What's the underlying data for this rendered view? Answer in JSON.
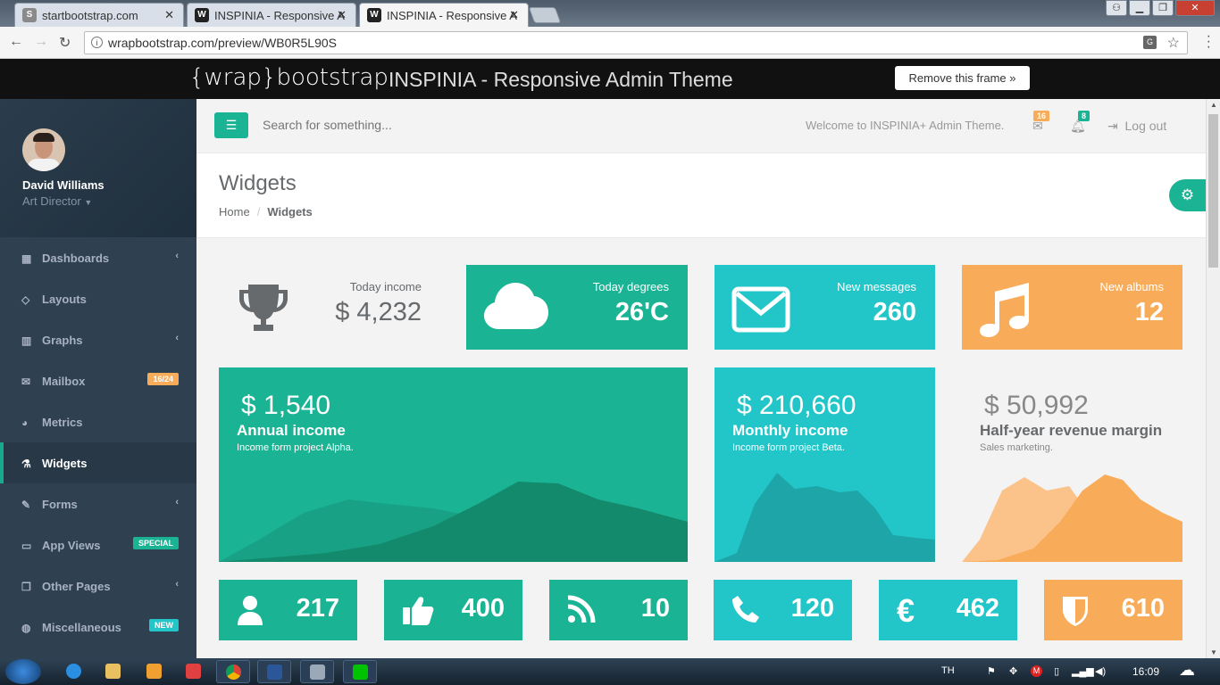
{
  "browser": {
    "tabs": [
      {
        "title": "startbootstrap.com",
        "favicon": "S",
        "active": false
      },
      {
        "title": "INSPINIA - Responsive A",
        "favicon": "W",
        "active": false
      },
      {
        "title": "INSPINIA - Responsive A",
        "favicon": "W",
        "active": true
      }
    ],
    "url": "wrapbootstrap.com/preview/WB0R5L90S"
  },
  "frame": {
    "logo": "{wrap}bootstrap",
    "title": "INSPINIA - Responsive Admin Theme",
    "remove_button": "Remove this frame »"
  },
  "profile": {
    "name": "David Williams",
    "role": "Art Director"
  },
  "sidebar": {
    "items": [
      {
        "label": "Dashboards",
        "icon": "th-large-icon",
        "glyph": "▦",
        "arrow": true
      },
      {
        "label": "Layouts",
        "icon": "diamond-icon",
        "glyph": "◇",
        "arrow": false
      },
      {
        "label": "Graphs",
        "icon": "bar-chart-icon",
        "glyph": "▥",
        "arrow": true
      },
      {
        "label": "Mailbox",
        "icon": "envelope-icon",
        "glyph": "✉",
        "badge": "16/24",
        "badge_color": "#f8ac59"
      },
      {
        "label": "Metrics",
        "icon": "pie-chart-icon",
        "glyph": "◕",
        "arrow": false
      },
      {
        "label": "Widgets",
        "icon": "flask-icon",
        "glyph": "⚗",
        "active": true
      },
      {
        "label": "Forms",
        "icon": "edit-icon",
        "glyph": "✎",
        "arrow": true
      },
      {
        "label": "App Views",
        "icon": "desktop-icon",
        "glyph": "▭",
        "badge": "SPECIAL",
        "badge_color": "#1ab394"
      },
      {
        "label": "Other Pages",
        "icon": "files-icon",
        "glyph": "❐",
        "arrow": true
      },
      {
        "label": "Miscellaneous",
        "icon": "globe-icon",
        "glyph": "◍",
        "badge": "NEW",
        "badge_color": "#23c6c8"
      }
    ]
  },
  "topbar": {
    "search_placeholder": "Search for something...",
    "welcome": "Welcome to INSPINIA+ Admin Theme.",
    "messages_count": "16",
    "alerts_count": "8",
    "logout": "Log out"
  },
  "page": {
    "title": "Widgets",
    "breadcrumb": [
      "Home",
      "Widgets"
    ]
  },
  "stats": [
    {
      "label": "Today income",
      "value": "$ 4,232",
      "icon": "trophy-icon",
      "color": "#f3f3f4"
    },
    {
      "label": "Today degrees",
      "value": "26'C",
      "icon": "cloud-icon",
      "color": "#1ab394"
    },
    {
      "label": "New messages",
      "value": "260",
      "icon": "envelope-icon",
      "color": "#23c6c8"
    },
    {
      "label": "New albums",
      "value": "12",
      "icon": "music-icon",
      "color": "#f8ac59"
    }
  ],
  "income": [
    {
      "value": "$ 1,540",
      "title": "Annual income",
      "subtitle": "Income form project Alpha.",
      "color": "#1ab394"
    },
    {
      "value": "$ 210,660",
      "title": "Monthly income",
      "subtitle": "Income form project Beta.",
      "color": "#23c6c8"
    },
    {
      "value": "$ 50,992",
      "title": "Half-year revenue margin",
      "subtitle": "Sales marketing.",
      "color": "#f3f3f4"
    }
  ],
  "small_stats": [
    {
      "value": "217",
      "icon": "user-icon",
      "color": "#1ab394"
    },
    {
      "value": "400",
      "icon": "thumbs-up-icon",
      "color": "#1ab394"
    },
    {
      "value": "10",
      "icon": "rss-icon",
      "color": "#1ab394"
    },
    {
      "value": "120",
      "icon": "phone-icon",
      "color": "#23c6c8"
    },
    {
      "value": "462",
      "icon": "euro-icon",
      "color": "#23c6c8"
    },
    {
      "value": "610",
      "icon": "shield-icon",
      "color": "#f8ac59"
    }
  ],
  "taskbar": {
    "lang": "TH",
    "time": "16:09"
  }
}
